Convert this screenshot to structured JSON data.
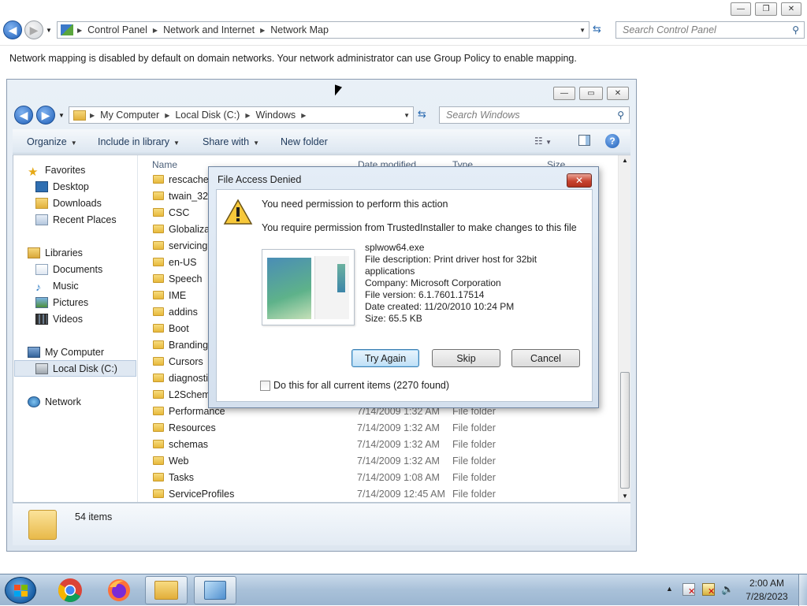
{
  "control_panel": {
    "breadcrumb": [
      "Control Panel",
      "Network and Internet",
      "Network Map"
    ],
    "search_placeholder": "Search Control Panel",
    "message": "Network mapping is disabled by default on domain networks. Your network administrator can use Group Policy to enable mapping."
  },
  "explorer": {
    "breadcrumb": [
      "My Computer",
      "Local Disk (C:)",
      "Windows"
    ],
    "search_placeholder": "Search Windows",
    "toolbar": {
      "organize": "Organize",
      "include_in_library": "Include in library",
      "share_with": "Share with",
      "new_folder": "New folder"
    },
    "nav": {
      "favorites": "Favorites",
      "desktop": "Desktop",
      "downloads": "Downloads",
      "recent_places": "Recent Places",
      "libraries": "Libraries",
      "documents": "Documents",
      "music": "Music",
      "pictures": "Pictures",
      "videos": "Videos",
      "my_computer": "My Computer",
      "local_disk": "Local Disk (C:)",
      "network": "Network"
    },
    "columns": {
      "name": "Name",
      "date_modified": "Date modified",
      "type": "Type",
      "size": "Size"
    },
    "rows": [
      {
        "name": "rescache"
      },
      {
        "name": "twain_32"
      },
      {
        "name": "CSC"
      },
      {
        "name": "Globalizat"
      },
      {
        "name": "servicing"
      },
      {
        "name": "en-US"
      },
      {
        "name": "Speech"
      },
      {
        "name": "IME"
      },
      {
        "name": "addins"
      },
      {
        "name": "Boot"
      },
      {
        "name": "Branding"
      },
      {
        "name": "Cursors"
      },
      {
        "name": "diagnosti"
      },
      {
        "name": "L2Schema"
      },
      {
        "name": "Performance",
        "date": "7/14/2009 1:32 AM",
        "type": "File folder"
      },
      {
        "name": "Resources",
        "date": "7/14/2009 1:32 AM",
        "type": "File folder"
      },
      {
        "name": "schemas",
        "date": "7/14/2009 1:32 AM",
        "type": "File folder"
      },
      {
        "name": "Web",
        "date": "7/14/2009 1:32 AM",
        "type": "File folder"
      },
      {
        "name": "Tasks",
        "date": "7/14/2009 1:08 AM",
        "type": "File folder"
      },
      {
        "name": "ServiceProfiles",
        "date": "7/14/2009 12:45 AM",
        "type": "File folder"
      }
    ],
    "item_count": "54 items"
  },
  "dialog": {
    "title": "File Access Denied",
    "heading": "You need permission to perform this action",
    "subheading": "You require permission from TrustedInstaller to make changes to this file",
    "file_name": "splwow64.exe",
    "file_description": "File description: Print driver host for 32bit applications",
    "company": "Company: Microsoft Corporation",
    "file_version": "File version: 6.1.7601.17514",
    "date_created": "Date created: 11/20/2010 10:24 PM",
    "size": "Size: 65.5 KB",
    "try_again": "Try Again",
    "skip": "Skip",
    "cancel": "Cancel",
    "checkbox_label": "Do this for all current items (2270 found)"
  },
  "taskbar": {
    "time": "2:00 AM",
    "date": "7/28/2023"
  }
}
